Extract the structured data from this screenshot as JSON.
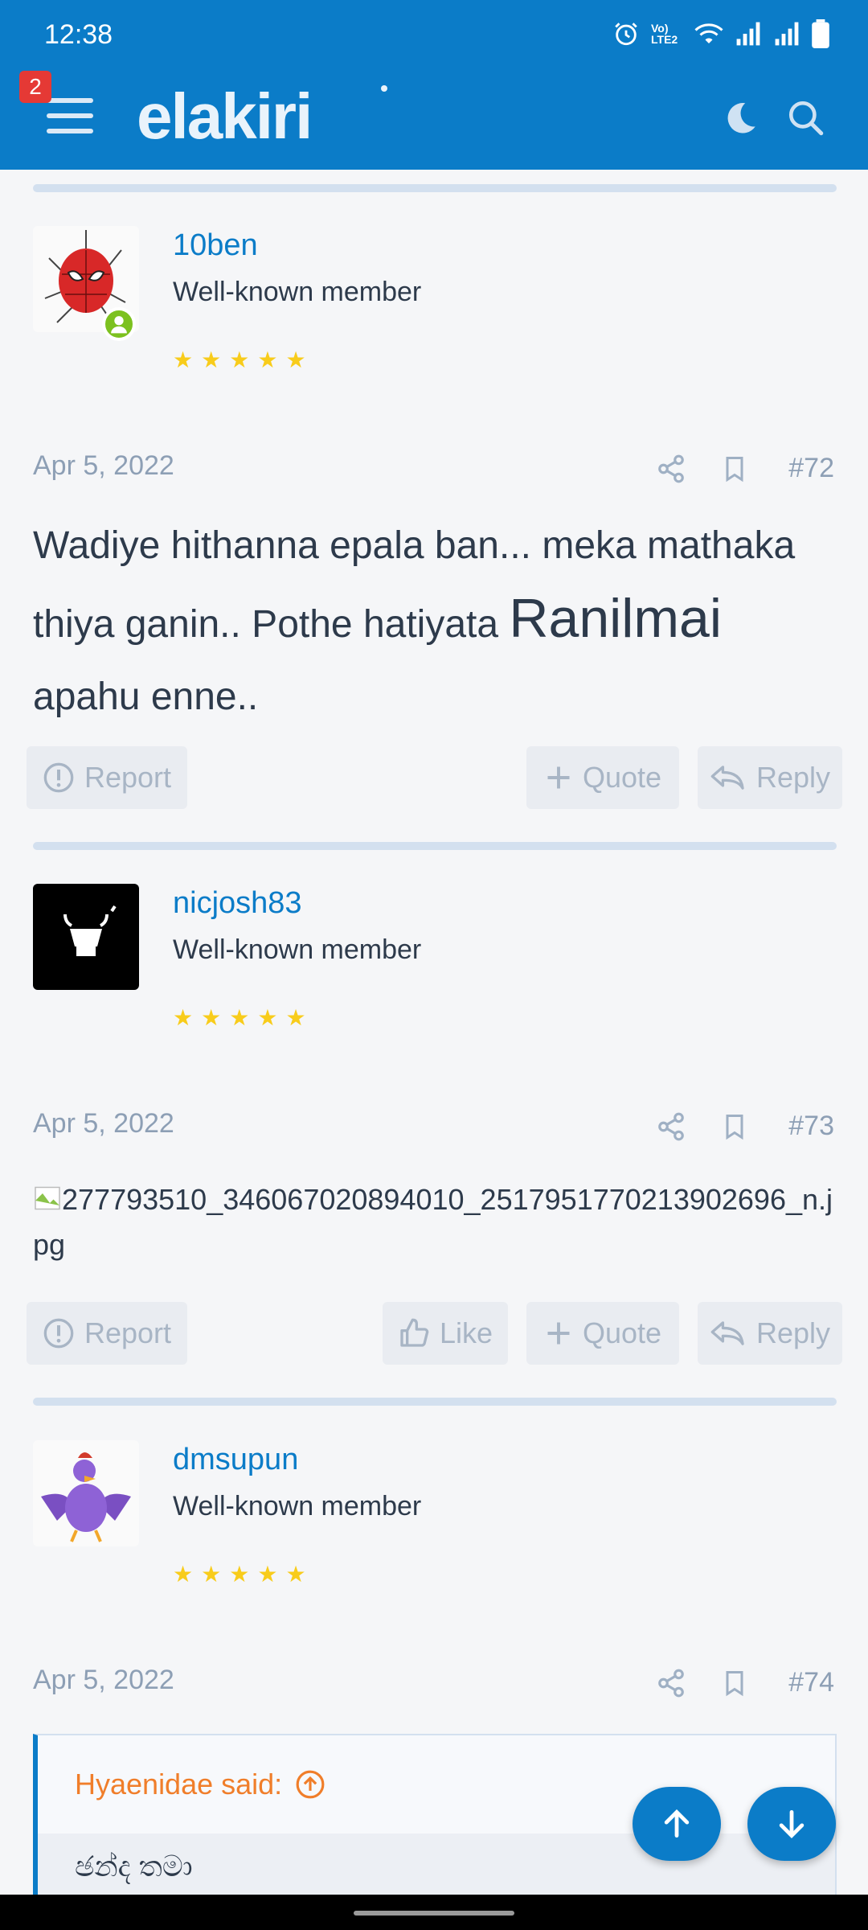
{
  "status": {
    "time": "12:38",
    "network_label": "Vo) LTE2"
  },
  "header": {
    "logo": "elakiri",
    "notification_count": "2"
  },
  "posts": [
    {
      "username": "10ben",
      "user_title": "Well-known member",
      "date": "Apr 5, 2022",
      "number": "#72",
      "body_part1": "Wadiye hithanna epala ban... meka mathaka thiya ganin.. Pothe hatiyata ",
      "body_big": "Ranilmai",
      "body_part2": " apahu enne..",
      "actions": {
        "report": "Report",
        "quote": "Quote",
        "reply": "Reply"
      }
    },
    {
      "username": "nicjosh83",
      "user_title": "Well-known member",
      "date": "Apr 5, 2022",
      "number": "#73",
      "image_alt": "277793510_346067020894010_2517951770213902696_n.jpg",
      "actions": {
        "report": "Report",
        "like": "Like",
        "quote": "Quote",
        "reply": "Reply"
      }
    },
    {
      "username": "dmsupun",
      "user_title": "Well-known member",
      "date": "Apr 5, 2022",
      "number": "#74",
      "quote_author": "Hyaenidae said:",
      "quote_text": "ඡන්ද තමා"
    }
  ],
  "colors": {
    "brand": "#0b7cc8",
    "stars": "#f8cc1b",
    "quote_author": "#f07e2a",
    "online": "#7cc11f"
  }
}
